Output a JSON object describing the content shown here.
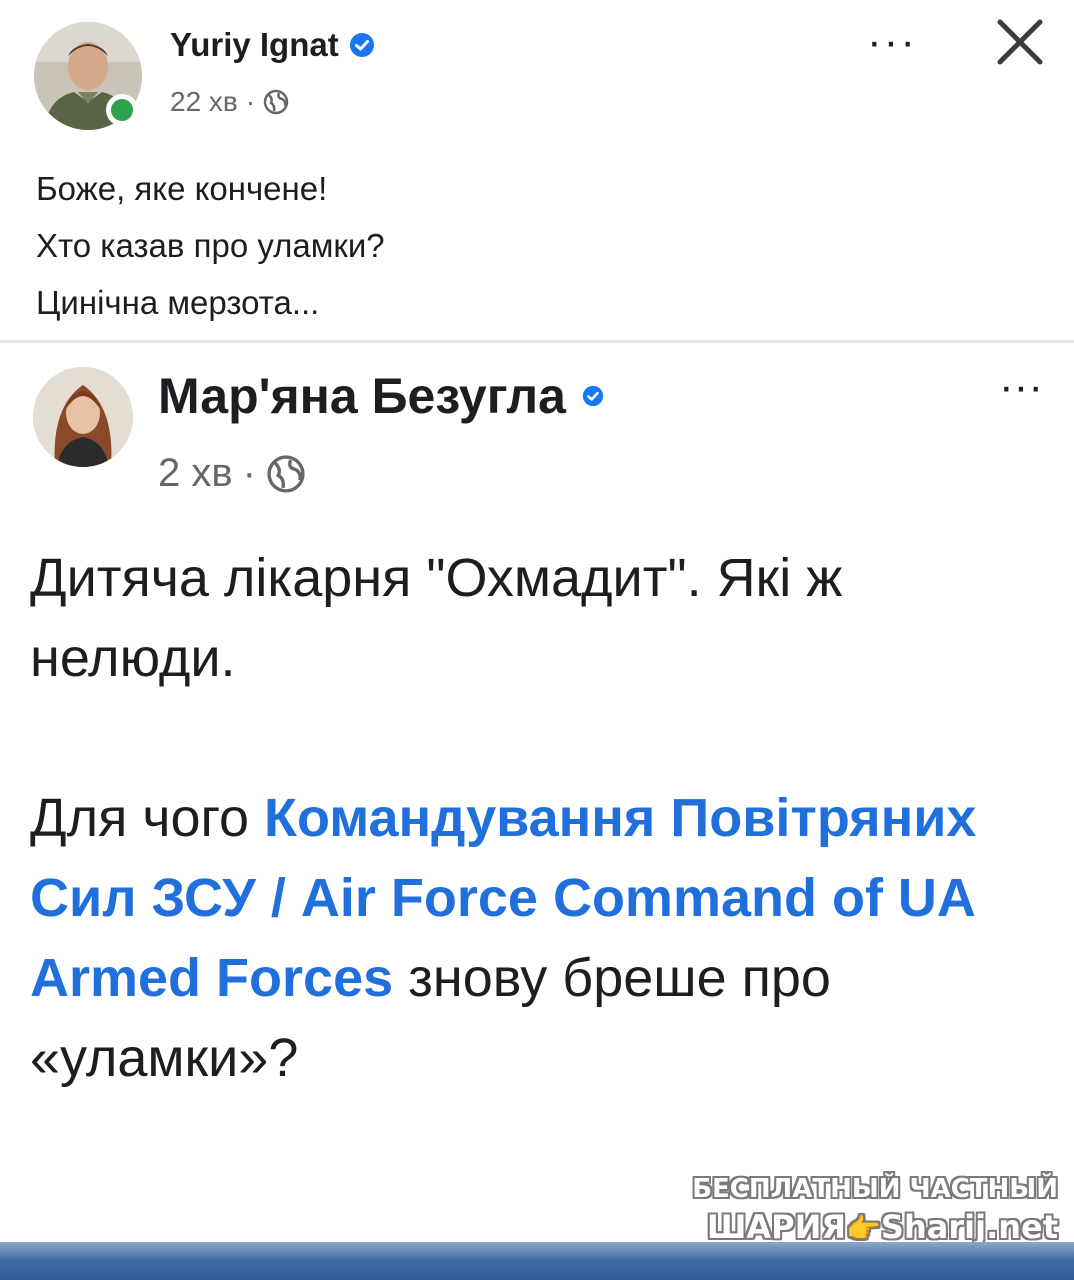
{
  "top_post": {
    "author": "Yuriy Ignat",
    "time": "22 хв",
    "separator": "·",
    "more_label": "···",
    "lines": [
      "Боже, яке кончене!",
      "Хто казав про уламки?",
      "Цинічна мерзота..."
    ]
  },
  "shared_post": {
    "author": "Мар'яна Безугла",
    "time": "2 хв",
    "separator": "·",
    "more_label": "···",
    "paragraph1": "Дитяча лікарня \"Охмадит\". Які ж нелюди.",
    "paragraph2_before": "Для чого ",
    "paragraph2_mention": "Командування Повітряних Сил ЗСУ / Air Force Command of UA Armed Forces",
    "paragraph2_after": " знову бреше про «уламки»?"
  },
  "watermark": {
    "line1": "БЕСПЛАТНЫЙ ЧАСТНЫЙ",
    "line2_left": "ШАРИЯ",
    "line2_hand": "👉",
    "line2_right": "Sharij.net"
  },
  "colors": {
    "verified": "#1877f2",
    "mention": "#216fdb",
    "online": "#31a24c",
    "meta_gray": "#65676b"
  },
  "icons": {
    "verified": "verified-badge-icon",
    "globe": "globe-icon",
    "more": "more-options-icon",
    "close": "close-icon"
  }
}
